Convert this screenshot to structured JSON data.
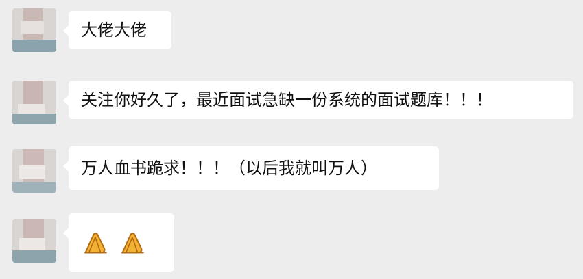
{
  "chat": {
    "messages": [
      {
        "text": "大佬大佬"
      },
      {
        "text": "关注你好久了，最近面试急缺一份系统的面试题库！！！"
      },
      {
        "text": "万人血书跪求！！！（以后我就叫万人）"
      },
      {
        "emojis": [
          "pray-hands-icon",
          "pray-hands-icon"
        ]
      }
    ]
  },
  "colors": {
    "background": "#ededed",
    "bubble": "#ffffff",
    "text": "#111111",
    "emoji_fill": "#f2b233",
    "emoji_stroke": "#b56a12"
  }
}
